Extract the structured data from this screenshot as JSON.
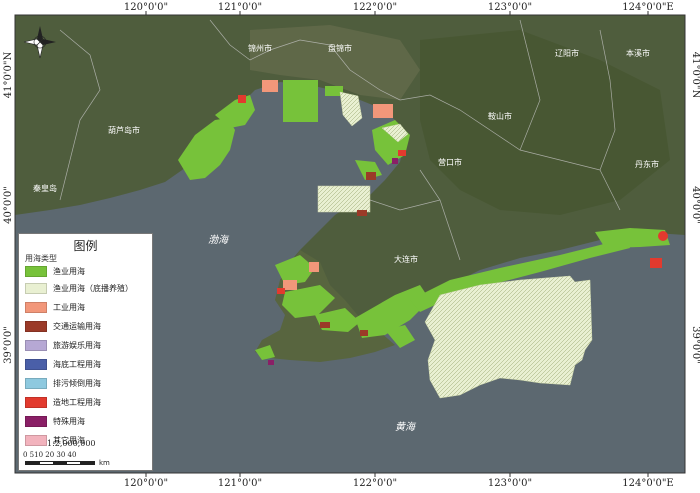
{
  "map": {
    "longitude_labels": [
      "120°0'0\"",
      "121°0'0\"",
      "122°0'0\"",
      "123°0'0\"",
      "124°0'0\"E"
    ],
    "latitude_labels": [
      "41°0'0\"N",
      "40°0'0\"",
      "39°0'0\""
    ],
    "cities": [
      "锦州市",
      "盘锦市",
      "辽阳市",
      "本溪市",
      "葫芦岛市",
      "鞍山市",
      "营口市",
      "丹东市",
      "秦皇岛",
      "大连市"
    ],
    "seas": [
      "渤海",
      "黄海"
    ],
    "colors": {
      "land": "#4e5d3c",
      "sea": "#5b6770",
      "fishery": "#7ec43c",
      "fishery_bottom": "#e8efcf"
    }
  },
  "legend": {
    "title": "图例",
    "subtitle": "用海类型",
    "items": [
      {
        "label": "渔业用海",
        "color": "#77c23a"
      },
      {
        "label": "渔业用海（底播养殖）",
        "color": "#e9f0d2"
      },
      {
        "label": "工业用海",
        "color": "#f2977a"
      },
      {
        "label": "交通运输用海",
        "color": "#9b3a28"
      },
      {
        "label": "旅游娱乐用海",
        "color": "#b6a8d4"
      },
      {
        "label": "海底工程用海",
        "color": "#4a5fa8"
      },
      {
        "label": "排污倾倒用海",
        "color": "#8ec9df"
      },
      {
        "label": "造地工程用海",
        "color": "#e23a2e"
      },
      {
        "label": "特殊用海",
        "color": "#8a1f66"
      },
      {
        "label": "其它用海",
        "color": "#f2b3bd"
      }
    ],
    "scale_ratio": "1:2,000,000",
    "scale_numbers": "0 510 20  30  40",
    "scale_unit": "km"
  }
}
